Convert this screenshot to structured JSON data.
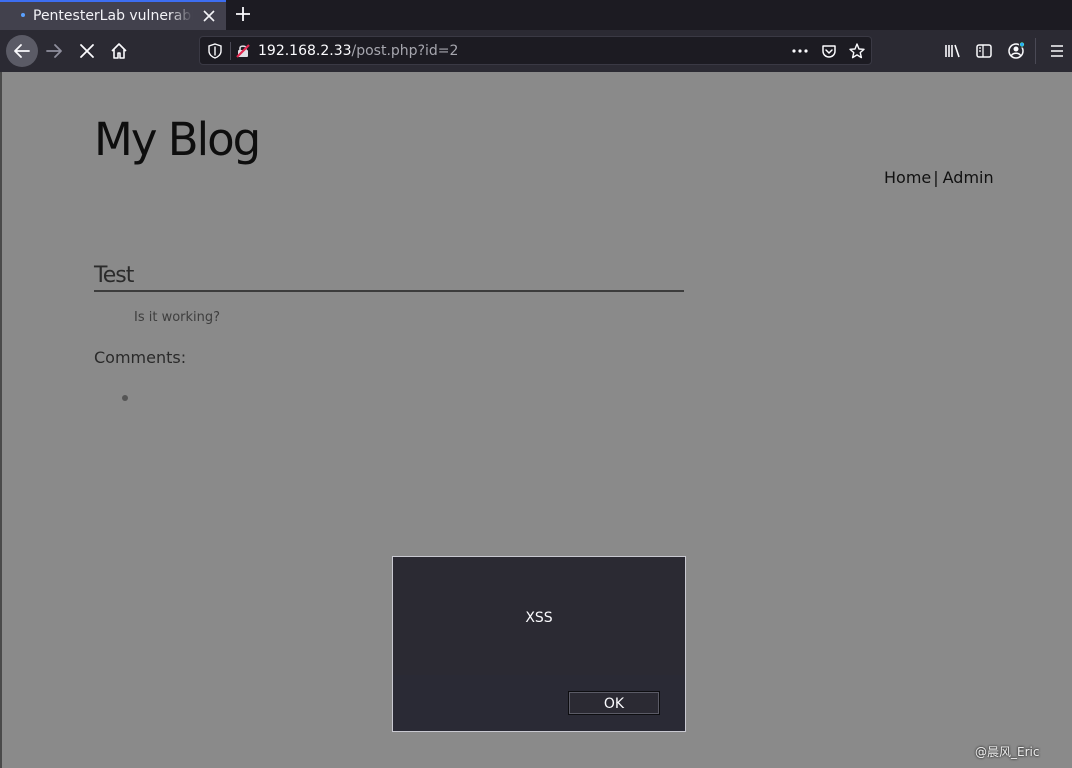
{
  "browser": {
    "tab_title": "PentesterLab vulnerable",
    "url_host": "192.168.2.33",
    "url_path": "/post.php?id=2",
    "icons": {
      "back": "back-arrow-icon",
      "forward": "forward-arrow-icon",
      "stop": "stop-icon",
      "home": "home-icon",
      "tracking": "shield-icon",
      "insecure": "insecure-lock-icon",
      "more": "more-dots-icon",
      "pocket": "pocket-icon",
      "bookmark": "star-icon",
      "library": "library-icon",
      "sidebar": "sidebar-icon",
      "account": "account-icon",
      "menu": "hamburger-menu-icon"
    }
  },
  "page": {
    "blog_title": "My Blog",
    "nav": {
      "home": "Home",
      "separator": "|",
      "admin": "Admin"
    },
    "post": {
      "title": "Test",
      "body": "Is it working?"
    },
    "comments_heading": "Comments:"
  },
  "dialog": {
    "message": "XSS",
    "ok_label": "OK"
  },
  "watermark": "@晨风_Eric",
  "colors": {
    "accent": "#3d6ef0",
    "page_background": "#8a8a8a",
    "chrome_dark": "#1c1b22"
  }
}
